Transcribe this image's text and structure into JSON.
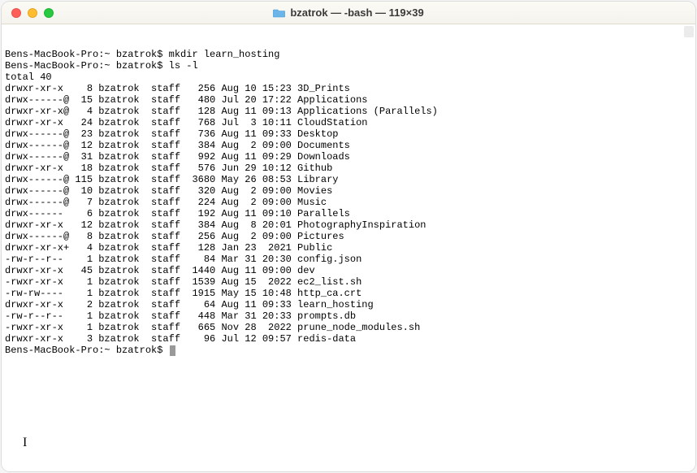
{
  "window": {
    "title": "bzatrok — -bash — 119×39"
  },
  "prompt": {
    "host": "Bens-MacBook-Pro",
    "path": "~",
    "user": "bzatrok",
    "symbol": "$"
  },
  "commands": {
    "cmd1": "mkdir learn_hosting",
    "cmd2": "ls -l"
  },
  "total_line": "total 40",
  "listing": [
    {
      "perms": "drwxr-xr-x  ",
      "links": "  8",
      "owner": "bzatrok",
      "group": "staff",
      "size": "  256",
      "date": "Aug 10 15:23",
      "name": "3D_Prints"
    },
    {
      "perms": "drwx------@ ",
      "links": " 15",
      "owner": "bzatrok",
      "group": "staff",
      "size": "  480",
      "date": "Jul 20 17:22",
      "name": "Applications"
    },
    {
      "perms": "drwxr-xr-x@ ",
      "links": "  4",
      "owner": "bzatrok",
      "group": "staff",
      "size": "  128",
      "date": "Aug 11 09:13",
      "name": "Applications (Parallels)"
    },
    {
      "perms": "drwxr-xr-x  ",
      "links": " 24",
      "owner": "bzatrok",
      "group": "staff",
      "size": "  768",
      "date": "Jul  3 10:11",
      "name": "CloudStation"
    },
    {
      "perms": "drwx------@ ",
      "links": " 23",
      "owner": "bzatrok",
      "group": "staff",
      "size": "  736",
      "date": "Aug 11 09:33",
      "name": "Desktop"
    },
    {
      "perms": "drwx------@ ",
      "links": " 12",
      "owner": "bzatrok",
      "group": "staff",
      "size": "  384",
      "date": "Aug  2 09:00",
      "name": "Documents"
    },
    {
      "perms": "drwx------@ ",
      "links": " 31",
      "owner": "bzatrok",
      "group": "staff",
      "size": "  992",
      "date": "Aug 11 09:29",
      "name": "Downloads"
    },
    {
      "perms": "drwxr-xr-x  ",
      "links": " 18",
      "owner": "bzatrok",
      "group": "staff",
      "size": "  576",
      "date": "Jun 29 10:12",
      "name": "Github"
    },
    {
      "perms": "drwx------@ ",
      "links": "115",
      "owner": "bzatrok",
      "group": "staff",
      "size": " 3680",
      "date": "May 26 08:53",
      "name": "Library"
    },
    {
      "perms": "drwx------@ ",
      "links": " 10",
      "owner": "bzatrok",
      "group": "staff",
      "size": "  320",
      "date": "Aug  2 09:00",
      "name": "Movies"
    },
    {
      "perms": "drwx------@ ",
      "links": "  7",
      "owner": "bzatrok",
      "group": "staff",
      "size": "  224",
      "date": "Aug  2 09:00",
      "name": "Music"
    },
    {
      "perms": "drwx------  ",
      "links": "  6",
      "owner": "bzatrok",
      "group": "staff",
      "size": "  192",
      "date": "Aug 11 09:10",
      "name": "Parallels"
    },
    {
      "perms": "drwxr-xr-x  ",
      "links": " 12",
      "owner": "bzatrok",
      "group": "staff",
      "size": "  384",
      "date": "Aug  8 20:01",
      "name": "PhotographyInspiration"
    },
    {
      "perms": "drwx------@ ",
      "links": "  8",
      "owner": "bzatrok",
      "group": "staff",
      "size": "  256",
      "date": "Aug  2 09:00",
      "name": "Pictures"
    },
    {
      "perms": "drwxr-xr-x+ ",
      "links": "  4",
      "owner": "bzatrok",
      "group": "staff",
      "size": "  128",
      "date": "Jan 23  2021",
      "name": "Public"
    },
    {
      "perms": "-rw-r--r--  ",
      "links": "  1",
      "owner": "bzatrok",
      "group": "staff",
      "size": "   84",
      "date": "Mar 31 20:30",
      "name": "config.json"
    },
    {
      "perms": "drwxr-xr-x  ",
      "links": " 45",
      "owner": "bzatrok",
      "group": "staff",
      "size": " 1440",
      "date": "Aug 11 09:00",
      "name": "dev"
    },
    {
      "perms": "-rwxr-xr-x  ",
      "links": "  1",
      "owner": "bzatrok",
      "group": "staff",
      "size": " 1539",
      "date": "Aug 15  2022",
      "name": "ec2_list.sh"
    },
    {
      "perms": "-rw-rw----  ",
      "links": "  1",
      "owner": "bzatrok",
      "group": "staff",
      "size": " 1915",
      "date": "May 15 10:48",
      "name": "http_ca.crt"
    },
    {
      "perms": "drwxr-xr-x  ",
      "links": "  2",
      "owner": "bzatrok",
      "group": "staff",
      "size": "   64",
      "date": "Aug 11 09:33",
      "name": "learn_hosting"
    },
    {
      "perms": "-rw-r--r--  ",
      "links": "  1",
      "owner": "bzatrok",
      "group": "staff",
      "size": "  448",
      "date": "Mar 31 20:33",
      "name": "prompts.db"
    },
    {
      "perms": "-rwxr-xr-x  ",
      "links": "  1",
      "owner": "bzatrok",
      "group": "staff",
      "size": "  665",
      "date": "Nov 28  2022",
      "name": "prune_node_modules.sh"
    },
    {
      "perms": "drwxr-xr-x  ",
      "links": "  3",
      "owner": "bzatrok",
      "group": "staff",
      "size": "   96",
      "date": "Jul 12 09:57",
      "name": "redis-data"
    }
  ]
}
